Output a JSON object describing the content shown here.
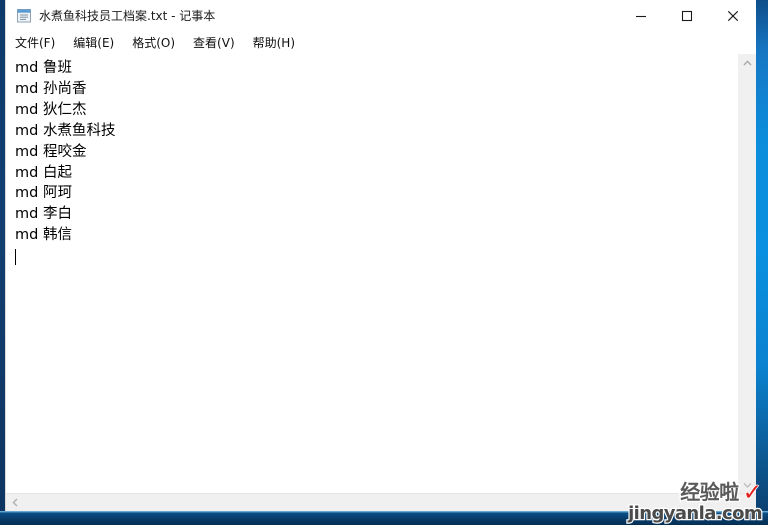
{
  "window": {
    "title": "水煮鱼科技员工档案.txt - 记事本",
    "icon": "notepad-icon",
    "controls": {
      "minimize": "—",
      "maximize": "☐",
      "close": "✕",
      "minimize_name": "minimize",
      "maximize_name": "maximize",
      "close_name": "close"
    }
  },
  "menubar": {
    "items": [
      {
        "label": "文件(F)"
      },
      {
        "label": "编辑(E)"
      },
      {
        "label": "格式(O)"
      },
      {
        "label": "查看(V)"
      },
      {
        "label": "帮助(H)"
      }
    ]
  },
  "document": {
    "lines": [
      "md 鲁班",
      "md 孙尚香",
      "md 狄仁杰",
      "md 水煮鱼科技",
      "md 程咬金",
      "md 白起",
      "md 阿珂",
      "md 李白",
      "md 韩信"
    ],
    "caret_line_index": 9
  },
  "scrollbars": {
    "vertical": {
      "up_arrow": "▲",
      "down_arrow": "▼"
    },
    "horizontal": {
      "left_arrow": "◀",
      "right_arrow": "▶"
    }
  },
  "watermark": {
    "brand_cn": "经验啦",
    "check": "✓",
    "url": "jingyanla.com"
  },
  "colors": {
    "window_bg": "#ffffff",
    "text": "#000000",
    "desktop_blue": "#0a90e0",
    "desktop_dark": "#0d3a6b",
    "scrollbar_bg": "#f0f0f0",
    "watermark_red": "#e21d1d"
  }
}
